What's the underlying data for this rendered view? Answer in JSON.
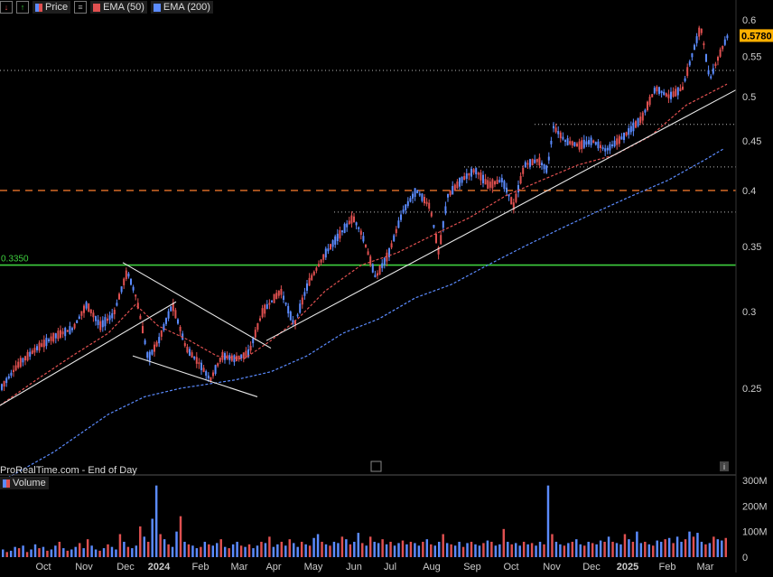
{
  "toolbar": {
    "price_label": "Price",
    "ema50_label": "EMA (50)",
    "ema200_label": "EMA (200)",
    "ema50_color": "#e05050",
    "ema200_color": "#5b8bff"
  },
  "chart_data": {
    "type": "candlestick",
    "scale": "log",
    "price_axis_ticks": [
      "0.6",
      "0.55",
      "0.5",
      "0.45",
      "0.4",
      "0.35",
      "0.3",
      "0.25"
    ],
    "time_axis_ticks": [
      "Oct",
      "Nov",
      "Dec",
      "2024",
      "Feb",
      "Mar",
      "Apr",
      "May",
      "Jun",
      "Jul",
      "Aug",
      "Sep",
      "Oct",
      "Nov",
      "Dec",
      "2025",
      "Feb",
      "Mar"
    ],
    "current_price": "0.5780",
    "horizontal_level": "0.3350",
    "level_color": "#3ecf3e",
    "orange_dashed_level": 0.4,
    "dotted_levels": [
      0.532,
      0.468,
      0.423,
      0.38
    ],
    "close_path": [
      [
        0,
        0.25
      ],
      [
        20,
        0.265
      ],
      [
        40,
        0.275
      ],
      [
        60,
        0.283
      ],
      [
        80,
        0.288
      ],
      [
        95,
        0.305
      ],
      [
        110,
        0.29
      ],
      [
        125,
        0.298
      ],
      [
        140,
        0.33
      ],
      [
        150,
        0.31
      ],
      [
        163,
        0.268
      ],
      [
        175,
        0.28
      ],
      [
        190,
        0.305
      ],
      [
        205,
        0.275
      ],
      [
        220,
        0.265
      ],
      [
        232,
        0.255
      ],
      [
        245,
        0.27
      ],
      [
        260,
        0.268
      ],
      [
        275,
        0.272
      ],
      [
        290,
        0.3
      ],
      [
        310,
        0.315
      ],
      [
        325,
        0.29
      ],
      [
        340,
        0.32
      ],
      [
        360,
        0.345
      ],
      [
        375,
        0.36
      ],
      [
        390,
        0.375
      ],
      [
        400,
        0.36
      ],
      [
        415,
        0.325
      ],
      [
        430,
        0.345
      ],
      [
        445,
        0.38
      ],
      [
        460,
        0.4
      ],
      [
        475,
        0.385
      ],
      [
        485,
        0.345
      ],
      [
        495,
        0.395
      ],
      [
        510,
        0.41
      ],
      [
        525,
        0.42
      ],
      [
        540,
        0.405
      ],
      [
        555,
        0.41
      ],
      [
        568,
        0.385
      ],
      [
        580,
        0.425
      ],
      [
        595,
        0.43
      ],
      [
        605,
        0.42
      ],
      [
        612,
        0.465
      ],
      [
        625,
        0.45
      ],
      [
        640,
        0.445
      ],
      [
        655,
        0.45
      ],
      [
        670,
        0.44
      ],
      [
        690,
        0.455
      ],
      [
        710,
        0.475
      ],
      [
        725,
        0.51
      ],
      [
        740,
        0.5
      ],
      [
        755,
        0.51
      ],
      [
        765,
        0.55
      ],
      [
        775,
        0.59
      ],
      [
        785,
        0.52
      ],
      [
        795,
        0.55
      ],
      [
        805,
        0.578
      ]
    ],
    "ema50_path": [
      [
        0,
        0.24
      ],
      [
        40,
        0.255
      ],
      [
        80,
        0.27
      ],
      [
        120,
        0.285
      ],
      [
        150,
        0.305
      ],
      [
        175,
        0.29
      ],
      [
        210,
        0.28
      ],
      [
        240,
        0.27
      ],
      [
        270,
        0.268
      ],
      [
        300,
        0.28
      ],
      [
        330,
        0.295
      ],
      [
        360,
        0.315
      ],
      [
        400,
        0.335
      ],
      [
        440,
        0.345
      ],
      [
        480,
        0.36
      ],
      [
        520,
        0.375
      ],
      [
        560,
        0.395
      ],
      [
        600,
        0.41
      ],
      [
        640,
        0.425
      ],
      [
        680,
        0.435
      ],
      [
        720,
        0.455
      ],
      [
        760,
        0.49
      ],
      [
        805,
        0.515
      ]
    ],
    "ema200_path": [
      [
        0,
        0.2
      ],
      [
        60,
        0.215
      ],
      [
        120,
        0.235
      ],
      [
        160,
        0.245
      ],
      [
        200,
        0.25
      ],
      [
        260,
        0.255
      ],
      [
        300,
        0.26
      ],
      [
        340,
        0.27
      ],
      [
        380,
        0.285
      ],
      [
        420,
        0.295
      ],
      [
        460,
        0.31
      ],
      [
        500,
        0.32
      ],
      [
        540,
        0.335
      ],
      [
        580,
        0.35
      ],
      [
        620,
        0.365
      ],
      [
        660,
        0.38
      ],
      [
        700,
        0.395
      ],
      [
        740,
        0.41
      ],
      [
        780,
        0.43
      ],
      [
        802,
        0.442
      ]
    ],
    "trendlines": [
      [
        [
          0,
          0.24
        ],
        [
          195,
          0.307
        ]
      ],
      [
        [
          136,
          0.337
        ],
        [
          300,
          0.275
        ]
      ],
      [
        [
          147,
          0.27
        ],
        [
          285,
          0.245
        ]
      ],
      [
        [
          295,
          0.28
        ],
        [
          815,
          0.508
        ]
      ]
    ],
    "watermark": "ProRealTime.com - End of Day",
    "volume_label": "Volume",
    "volume_ticks": [
      "300M",
      "200M",
      "100M",
      "0"
    ],
    "volume_bars": [
      30,
      20,
      25,
      40,
      35,
      45,
      20,
      30,
      50,
      35,
      40,
      25,
      30,
      45,
      60,
      35,
      25,
      30,
      40,
      55,
      35,
      70,
      45,
      30,
      25,
      35,
      50,
      40,
      30,
      90,
      60,
      40,
      35,
      45,
      120,
      80,
      60,
      150,
      280,
      90,
      70,
      50,
      40,
      100,
      160,
      60,
      50,
      45,
      35,
      40,
      60,
      50,
      45,
      55,
      70,
      40,
      35,
      50,
      60,
      45,
      40,
      50,
      35,
      45,
      60,
      55,
      80,
      40,
      50,
      60,
      45,
      70,
      55,
      40,
      60,
      50,
      45,
      75,
      90,
      60,
      50,
      45,
      60,
      55,
      80,
      70,
      50,
      60,
      95,
      55,
      45,
      80,
      60,
      55,
      70,
      50,
      60,
      45,
      55,
      65,
      50,
      60,
      55,
      45,
      60,
      70,
      50,
      45,
      60,
      90,
      55,
      50,
      45,
      60,
      40,
      55,
      60,
      50,
      45,
      55,
      65,
      60,
      45,
      50,
      110,
      60,
      50,
      55,
      45,
      60,
      50,
      55,
      45,
      60,
      50,
      280,
      90,
      60,
      50,
      45,
      55,
      60,
      70,
      50,
      45,
      60,
      55,
      50,
      65,
      60,
      80,
      60,
      55,
      50,
      90,
      70,
      60,
      100,
      55,
      60,
      50,
      45,
      65,
      60,
      70,
      75,
      55,
      80,
      60,
      70,
      100,
      80,
      95,
      60,
      50,
      55,
      80,
      70,
      65,
      75
    ]
  }
}
